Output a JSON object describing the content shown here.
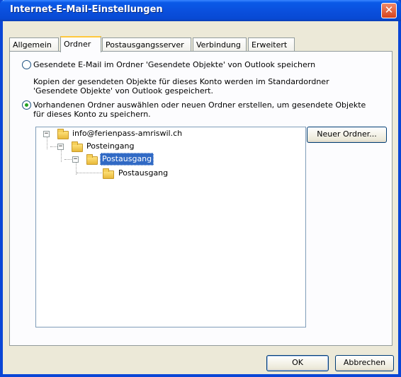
{
  "window": {
    "title": "Internet-E-Mail-Einstellungen",
    "close_glyph": "✕"
  },
  "tabs": [
    {
      "label": "Allgemein"
    },
    {
      "label": "Ordner"
    },
    {
      "label": "Postausgangsserver"
    },
    {
      "label": "Verbindung"
    },
    {
      "label": "Erweitert"
    }
  ],
  "active_tab": "Ordner",
  "options": {
    "save_default": {
      "label": "Gesendete E-Mail im Ordner 'Gesendete Objekte' von Outlook speichern",
      "description_line1": "Kopien der gesendeten Objekte für dieses Konto werden im Standardordner",
      "description_line2": "'Gesendete Objekte' von Outlook gespeichert.",
      "checked": false
    },
    "choose_folder": {
      "label_line1": "Vorhandenen Ordner auswählen oder neuen Ordner erstellen, um gesendete Objekte",
      "label_line2": "für dieses Konto zu speichern.",
      "checked": true
    }
  },
  "tree": {
    "account": "info@ferienpass-amriswil.ch",
    "inbox": "Posteingang",
    "outbox_selected": "Postausgang",
    "outbox_child": "Postausgang",
    "expander_minus": "−"
  },
  "buttons": {
    "new_folder": "Neuer Ordner...",
    "ok": "OK",
    "cancel": "Abbrechen"
  },
  "colors": {
    "titlebar": "#0a50de",
    "selection": "#316ac5",
    "dialog_bg": "#ece9d8"
  }
}
